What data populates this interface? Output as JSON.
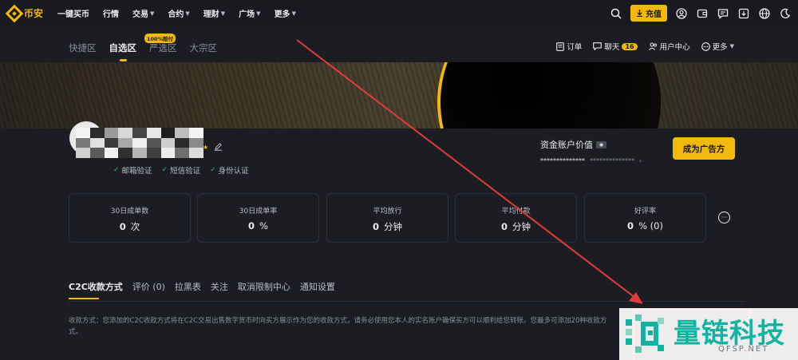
{
  "brand": {
    "name": "币安",
    "color": "#f0b90b"
  },
  "topnav": {
    "items": [
      {
        "label": "一键买币",
        "dropdown": false
      },
      {
        "label": "行情",
        "dropdown": false
      },
      {
        "label": "交易",
        "dropdown": true
      },
      {
        "label": "合约",
        "dropdown": true
      },
      {
        "label": "理财",
        "dropdown": true
      },
      {
        "label": "广场",
        "dropdown": true
      },
      {
        "label": "更多",
        "dropdown": true
      }
    ],
    "deposit_label": "充值",
    "icons": [
      "search-icon",
      "user-icon",
      "wallet-icon",
      "message-icon",
      "download-icon",
      "globe-icon",
      "moon-icon"
    ]
  },
  "subnav": {
    "tabs": [
      "快捷区",
      "自选区",
      "严选区",
      "大宗区"
    ],
    "active_tab": "自选区",
    "guarantee_badge": "100%赔付",
    "right": {
      "orders": "订单",
      "chat": "聊天",
      "chat_count": "16",
      "user_center": "用户中心",
      "more": "更多"
    }
  },
  "profile": {
    "verifications": [
      "邮箱验证",
      "短信验证",
      "身份认证"
    ],
    "asset_title": "资金账户价值",
    "asset_value": "**************",
    "asset_sub": "**************",
    "become_advertiser": "成为广告方"
  },
  "stats": [
    {
      "label": "30日成单数",
      "value": "0",
      "unit": "次"
    },
    {
      "label": "30日成单率",
      "value": "0",
      "unit": "%"
    },
    {
      "label": "平均放行",
      "value": "0",
      "unit": "分钟"
    },
    {
      "label": "平均付款",
      "value": "0",
      "unit": "分钟"
    },
    {
      "label": "好评率",
      "value": "0",
      "unit": "% (0)"
    }
  ],
  "bottom_tabs": [
    "C2C收款方式",
    "评价 (0)",
    "拉黑表",
    "关注",
    "取消限制中心",
    "通知设置"
  ],
  "bottom_active": "C2C收款方式",
  "description": "收款方式：您添加的C2C收款方式将在C2C交易出售数字货币时向买方展示作为您的收款方式，请务必使用您本人的实名账户确保买方可以顺利给您转账。您最多可添加20种收款方式。",
  "watermark": {
    "title": "量链科技",
    "sub": "QFSP.NET"
  },
  "colors": {
    "accent": "#f0b90b",
    "success": "#2ebd85",
    "annotation": "#e03c3c",
    "watermark": "#12b3a0"
  }
}
